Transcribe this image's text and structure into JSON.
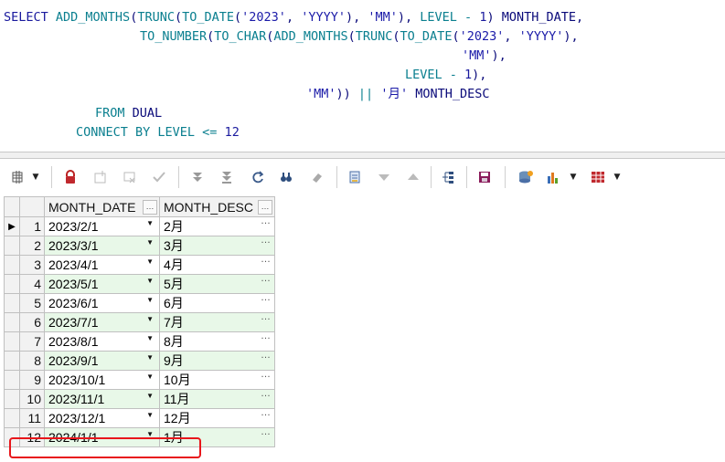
{
  "sql": {
    "line1": {
      "t1": "SELECT ",
      "t2": "ADD_MONTHS",
      "t3": "(",
      "t4": "TRUNC",
      "t5": "(",
      "t6": "TO_DATE",
      "t7": "(",
      "t8": "'2023'",
      "t9": ", ",
      "t10": "'YYYY'",
      "t11": "), ",
      "t12": "'MM'",
      "t13": "), ",
      "t14": "LEVEL",
      "t15": " - ",
      "t16": "1",
      "t17": ") ",
      "t18": "MONTH_DATE",
      "t19": ","
    },
    "line2": {
      "t1": "TO_NUMBER",
      "t2": "(",
      "t3": "TO_CHAR",
      "t4": "(",
      "t5": "ADD_MONTHS",
      "t6": "(",
      "t7": "TRUNC",
      "t8": "(",
      "t9": "TO_DATE",
      "t10": "(",
      "t11": "'2023'",
      "t12": ", ",
      "t13": "'YYYY'",
      "t14": "),"
    },
    "line3": {
      "t1": "'MM'",
      "t2": "),"
    },
    "line4": {
      "t1": "LEVEL",
      "t2": " - ",
      "t3": "1",
      "t4": "),"
    },
    "line5": {
      "t1": "'MM'",
      "t2": ")) ",
      "t3": "||",
      "t4": " ",
      "t5": "'月'",
      "t6": " MONTH_DESC"
    },
    "line6": {
      "t1": "FROM ",
      "t2": "DUAL"
    },
    "line7": {
      "t1": "CONNECT BY ",
      "t2": "LEVEL",
      "t3": " <= ",
      "t4": "12"
    }
  },
  "toolbar": {
    "icons": [
      "grid-options-icon",
      "lock-icon",
      "add-record-icon",
      "delete-record-icon",
      "post-changes-icon",
      "fetch-next-page-icon",
      "fetch-last-page-icon",
      "refresh-icon",
      "find-icon",
      "clear-icon",
      "single-record-view-icon",
      "sort-desc-icon",
      "sort-asc-icon",
      "query-by-example-icon",
      "save-icon",
      "export-icon",
      "chart-icon",
      "table-view-icon"
    ]
  },
  "grid": {
    "columns": [
      "MONTH_DATE",
      "MONTH_DESC"
    ],
    "header_menu_glyph": "…",
    "current_row_marker": "▶",
    "rows": [
      {
        "num": "1",
        "date": "2023/2/1",
        "desc": "2月"
      },
      {
        "num": "2",
        "date": "2023/3/1",
        "desc": "3月"
      },
      {
        "num": "3",
        "date": "2023/4/1",
        "desc": "4月"
      },
      {
        "num": "4",
        "date": "2023/5/1",
        "desc": "5月"
      },
      {
        "num": "5",
        "date": "2023/6/1",
        "desc": "6月"
      },
      {
        "num": "6",
        "date": "2023/7/1",
        "desc": "7月"
      },
      {
        "num": "7",
        "date": "2023/8/1",
        "desc": "8月"
      },
      {
        "num": "8",
        "date": "2023/9/1",
        "desc": "9月"
      },
      {
        "num": "9",
        "date": "2023/10/1",
        "desc": "10月"
      },
      {
        "num": "10",
        "date": "2023/11/1",
        "desc": "11月"
      },
      {
        "num": "11",
        "date": "2023/12/1",
        "desc": "12月"
      },
      {
        "num": "12",
        "date": "2024/1/1",
        "desc": "1月"
      }
    ],
    "highlight_color": "#e8161b",
    "alt_row_color": "#e8f8e8"
  }
}
